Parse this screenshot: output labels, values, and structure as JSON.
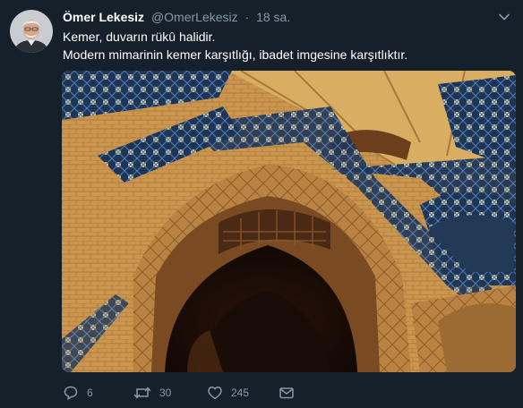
{
  "tweet": {
    "author": {
      "display_name": "Ömer Lekesiz",
      "handle": "@OmerLekesiz",
      "separator": "·",
      "time": "18 sa."
    },
    "text_lines": [
      "Kemer, duvarın rükû halidir.",
      "Modern mimarinin kemer karşıtlığı, ibadet imgesine karşıtlıktır."
    ],
    "actions": {
      "reply_count": "6",
      "retweet_count": "30",
      "like_count": "245"
    }
  },
  "icons": {
    "caret": "chevron-down-icon",
    "reply": "speech-bubble-icon",
    "retweet": "retweet-arrows-icon",
    "like": "heart-icon",
    "share": "envelope-icon"
  },
  "colors": {
    "background": "#15202b",
    "secondary_text": "#8899a6",
    "primary_text": "#ffffff"
  }
}
